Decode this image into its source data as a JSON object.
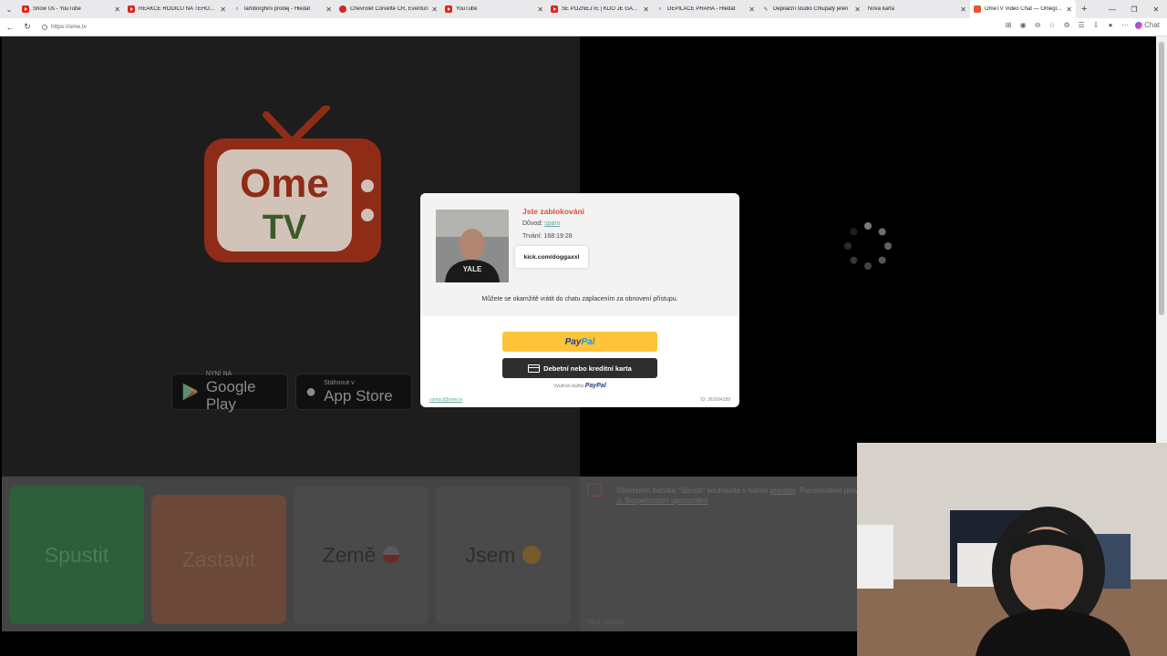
{
  "browser": {
    "tabs": [
      {
        "title": "Show Us - YouTube",
        "icon": "youtube-icon"
      },
      {
        "title": "REAKCE RODIČŮ NA TĚHOTNÉ D",
        "icon": "youtube-icon"
      },
      {
        "title": "lamborghini prodej - Hledat",
        "icon": "search-icon"
      },
      {
        "title": "Chevrolet Corvette ČR, Eventuri",
        "icon": "chevrolet-icon"
      },
      {
        "title": "YouTube",
        "icon": "youtube-icon"
      },
      {
        "title": "SE POZNEJTE | KDO JE GAY? | Gr",
        "icon": "youtube-icon"
      },
      {
        "title": "DEPILACE PRAHA - Hledat",
        "icon": "search-icon"
      },
      {
        "title": "Depilační studio Chlupatý jelen",
        "icon": "brush-icon"
      },
      {
        "title": "Nová karta",
        "icon": "page-icon"
      },
      {
        "title": "OmeTV Video Chat — Omegle A",
        "icon": "ometv-icon"
      }
    ],
    "url": "https://ome.tv",
    "chat_label": "Chat"
  },
  "logo": {
    "line1": "Ome",
    "line2": "TV"
  },
  "stores": {
    "google": {
      "small": "NYNÍ NA",
      "big": "Google Play"
    },
    "apple": {
      "small": "Stáhnout v",
      "big": "App Store"
    }
  },
  "controls": {
    "start": "Spustit",
    "stop": "Zastavit",
    "country": "Země",
    "iam": "Jsem"
  },
  "chat": {
    "notice_line1": "Stisknutím tlačítka \"Spustit\" souhlasíte s naším",
    "notice_link": "pravidla",
    "notice_line1_end": ". Porušovatelé pravidel",
    "notice_line2": "⚠ Bezpečnostní upozornění",
    "input_placeholder": "Text zprávy..."
  },
  "modal": {
    "title": "Jste zablokováni",
    "reason_label": "Důvod:",
    "reason_value": "spam",
    "duration": "Trvání: 168:19:28",
    "kick": "kick.com/doggaxxl",
    "message": "Můžete se okamžitě vrátit do chatu zaplacením za obnovení přístupu.",
    "paypal_pay": "Pay",
    "paypal_pal": "Pal",
    "card": "Debetní nebo kreditní karta",
    "powered_text": "Využívá služby",
    "powered_brand": "PayPal",
    "contact": "contact@ome.tv",
    "id": "ID: 362994189"
  },
  "colors": {
    "start": "#2f9e4f",
    "stop": "#e98c6c",
    "accent": "#d9532c",
    "paypal_yellow": "#ffc439"
  }
}
